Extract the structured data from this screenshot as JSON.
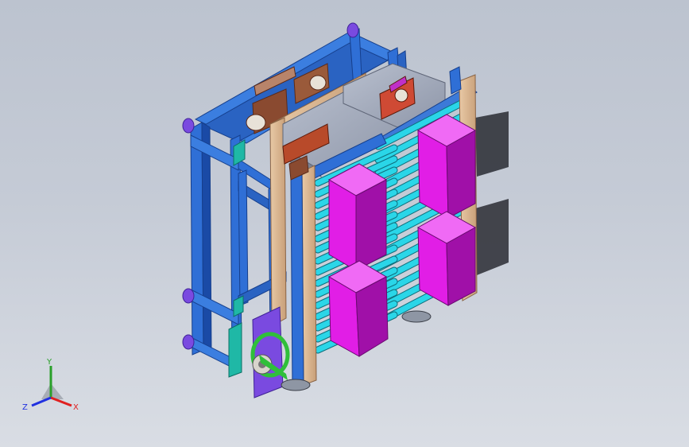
{
  "viewport": {
    "colors": {
      "frame_blue": "#2f6fd6",
      "frame_dark": "#1a4aa6",
      "roller_cyan": "#29d8e8",
      "roller_dark": "#0f8fa0",
      "box_magenta": "#e11ee6",
      "box_dark": "#a010a8",
      "panel_tan": "#d8b896",
      "foot_purple": "#7a4ae0",
      "teal_bracket": "#1fb8a6",
      "orange_part": "#e06b2a",
      "gray_plate": "#9ea6b8"
    },
    "model_name": "conveyor-rack-assembly"
  },
  "triad": {
    "x_label": "X",
    "y_label": "Y",
    "z_label": "Z",
    "x_color": "#e02020",
    "y_color": "#2aa02a",
    "z_color": "#2030e0"
  }
}
